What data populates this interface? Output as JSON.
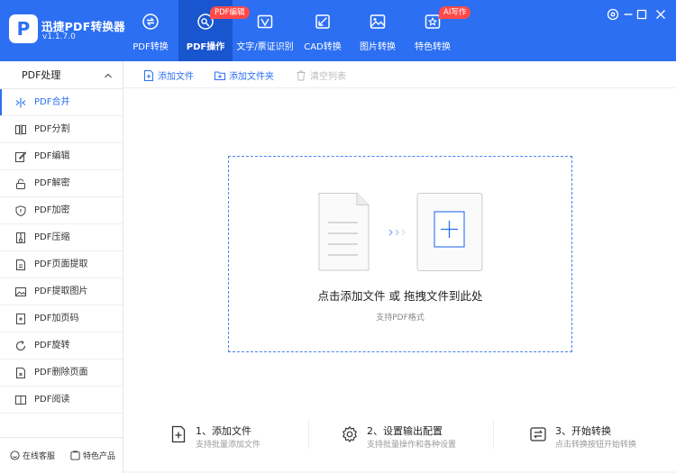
{
  "app": {
    "name": "迅捷PDF转换器",
    "version": "v1.1.7.0",
    "logo_letter": "P"
  },
  "nav": {
    "tabs": [
      {
        "label": "PDF转换",
        "icon": "convert-icon",
        "badge": ""
      },
      {
        "label": "PDF操作",
        "icon": "pdf-operate-icon",
        "badge": "PDF编辑",
        "active": true
      },
      {
        "label": "文字/票证识别",
        "icon": "ocr-icon",
        "badge": ""
      },
      {
        "label": "CAD转换",
        "icon": "cad-icon",
        "badge": ""
      },
      {
        "label": "图片转换",
        "icon": "image-icon",
        "badge": ""
      },
      {
        "label": "特色转换",
        "icon": "special-icon",
        "badge": "AI写作"
      }
    ]
  },
  "window_controls": [
    "settings-icon",
    "minimize-icon",
    "maximize-icon",
    "close-icon"
  ],
  "sidebar": {
    "header": "PDF处理",
    "items": [
      {
        "label": "PDF合并",
        "icon": "merge-icon",
        "active": true
      },
      {
        "label": "PDF分割",
        "icon": "split-icon"
      },
      {
        "label": "PDF编辑",
        "icon": "edit-icon"
      },
      {
        "label": "PDF解密",
        "icon": "unlock-icon"
      },
      {
        "label": "PDF加密",
        "icon": "shield-icon"
      },
      {
        "label": "PDF压缩",
        "icon": "compress-icon"
      },
      {
        "label": "PDF页面提取",
        "icon": "extract-page-icon"
      },
      {
        "label": "PDF提取图片",
        "icon": "extract-image-icon"
      },
      {
        "label": "PDF加页码",
        "icon": "page-number-icon"
      },
      {
        "label": "PDF旋转",
        "icon": "rotate-icon"
      },
      {
        "label": "PDF删除页面",
        "icon": "delete-page-icon"
      },
      {
        "label": "PDF阅读",
        "icon": "book-icon"
      }
    ],
    "footer": {
      "service": "在线客服",
      "features": "特色产品"
    }
  },
  "toolbar": {
    "add_file": "添加文件",
    "add_folder": "添加文件夹",
    "clear_list": "清空列表"
  },
  "dropzone": {
    "main": "点击添加文件 或 拖拽文件到此处",
    "sub": "支持PDF格式"
  },
  "steps": [
    {
      "title": "1、添加文件",
      "desc": "支持批量添加文件",
      "icon": "add-file-icon"
    },
    {
      "title": "2、设置输出配置",
      "desc": "支持批量操作和各种设置",
      "icon": "gear-icon"
    },
    {
      "title": "3、开始转换",
      "desc": "点击转换按钮开始转换",
      "icon": "start-convert-icon"
    }
  ],
  "colors": {
    "primary": "#2c6ff2",
    "active_tab": "#1955cf",
    "badge": "#ff4a4a"
  }
}
